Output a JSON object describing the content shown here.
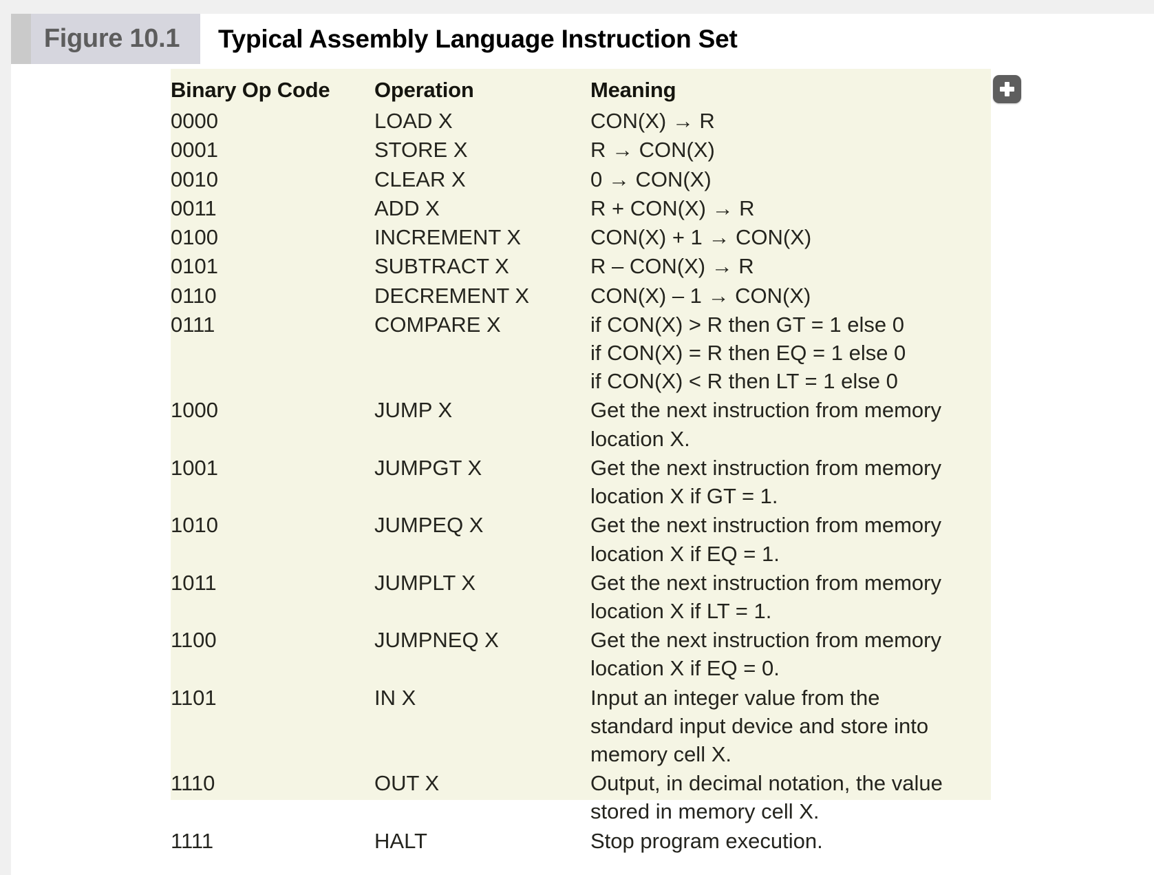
{
  "figure": {
    "tag": "Figure 10.1",
    "title": "Typical Assembly Language Instruction Set"
  },
  "controls": {
    "add_button_icon": "plus-icon",
    "add_button_label": "+"
  },
  "table": {
    "headers": [
      "Binary Op Code",
      "Operation",
      "Meaning"
    ],
    "rows": [
      {
        "opcode": "0000",
        "operation": "LOAD X",
        "meaning": "CON(X) → R"
      },
      {
        "opcode": "0001",
        "operation": "STORE X",
        "meaning": "R → CON(X)"
      },
      {
        "opcode": "0010",
        "operation": "CLEAR X",
        "meaning": "0 → CON(X)"
      },
      {
        "opcode": "0011",
        "operation": "ADD X",
        "meaning": "R + CON(X) → R"
      },
      {
        "opcode": "0100",
        "operation": "INCREMENT X",
        "meaning": "CON(X) + 1 → CON(X)"
      },
      {
        "opcode": "0101",
        "operation": "SUBTRACT X",
        "meaning": "R – CON(X) → R"
      },
      {
        "opcode": "0110",
        "operation": "DECREMENT X",
        "meaning": "CON(X) – 1 → CON(X)"
      },
      {
        "opcode": "0111",
        "operation": "COMPARE X",
        "meaning": "if CON(X) > R then GT = 1 else 0\nif CON(X) = R then EQ = 1 else 0\nif CON(X) < R then LT = 1 else 0"
      },
      {
        "opcode": "1000",
        "operation": "JUMP X",
        "meaning": "Get the next instruction from memory\nlocation X."
      },
      {
        "opcode": "1001",
        "operation": "JUMPGT X",
        "meaning": "Get the next instruction from memory\nlocation X if GT = 1."
      },
      {
        "opcode": "1010",
        "operation": "JUMPEQ X",
        "meaning": "Get the next instruction from memory\nlocation X if EQ = 1."
      },
      {
        "opcode": "1011",
        "operation": "JUMPLT X",
        "meaning": "Get the next instruction from memory\nlocation X if LT = 1."
      },
      {
        "opcode": "1100",
        "operation": "JUMPNEQ X",
        "meaning": "Get the next instruction from memory\nlocation X if EQ = 0."
      },
      {
        "opcode": "1101",
        "operation": "IN X",
        "meaning": "Input an integer value from the\nstandard input device and store into\nmemory cell X."
      },
      {
        "opcode": "1110",
        "operation": "OUT X",
        "meaning": "Output, in decimal notation, the value\nstored in memory cell X."
      },
      {
        "opcode": "1111",
        "operation": "HALT",
        "meaning": "Stop program execution."
      }
    ]
  },
  "colors": {
    "panel_background": "#f5f5e4",
    "figure_tag_background": "#d6d6de",
    "figure_tag_text": "#5d5d5d",
    "page_chrome": "#f0f0f0",
    "add_button": "#5e5e5e",
    "body_text": "#24241e"
  }
}
